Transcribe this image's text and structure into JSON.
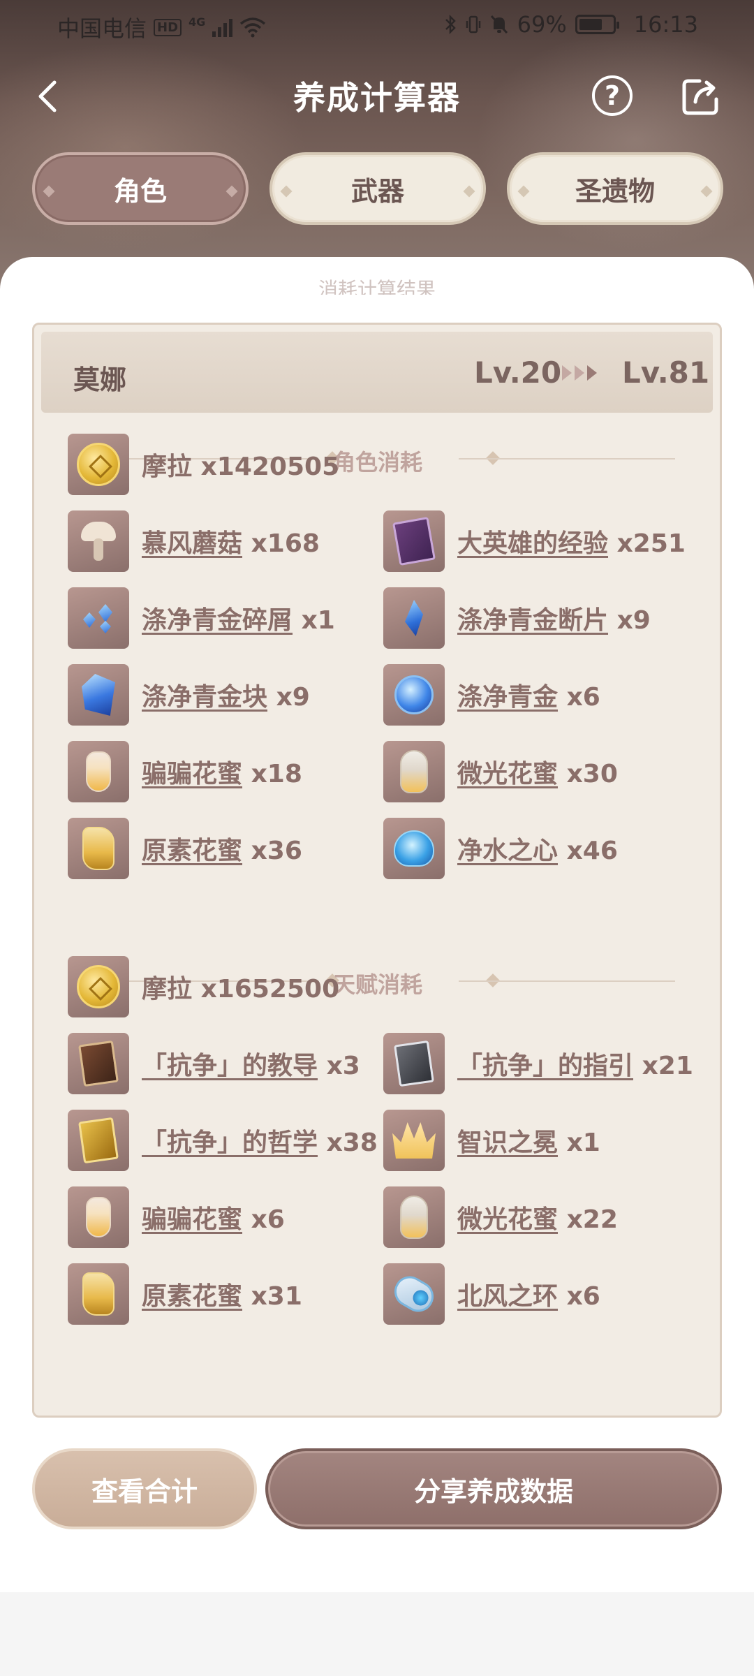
{
  "status_bar": {
    "carrier": "中国电信",
    "network_badge": "HD",
    "network_type": "4G",
    "battery_percent": "69%",
    "battery_level": 0.69,
    "time": "16:13"
  },
  "header": {
    "title": "养成计算器",
    "help_symbol": "?",
    "icons": {
      "back": "chevron-left-icon",
      "help": "question-circle-icon",
      "share": "share-icon"
    }
  },
  "tabs": [
    {
      "label": "角色",
      "active": true
    },
    {
      "label": "武器",
      "active": false
    },
    {
      "label": "圣遗物",
      "active": false
    }
  ],
  "sheet": {
    "subtitle": "消耗计算结果"
  },
  "character": {
    "name": "莫娜",
    "level_from": "Lv.20",
    "level_to": "Lv.81"
  },
  "sections": [
    {
      "title": "角色消耗",
      "items": [
        {
          "name": "摩拉",
          "qty": "x1420505",
          "icon": "mora-coin-icon",
          "link": false
        },
        {
          "name": "慕风蘑菇",
          "qty": "x168",
          "icon": "mushroom-icon",
          "link": true
        },
        {
          "name": "大英雄的经验",
          "qty": "x251",
          "icon": "exp-book-icon",
          "link": true
        },
        {
          "name": "涤净青金碎屑",
          "qty": "x1",
          "icon": "lapis-sliver-icon",
          "link": true
        },
        {
          "name": "涤净青金断片",
          "qty": "x9",
          "icon": "lapis-fragment-icon",
          "link": true
        },
        {
          "name": "涤净青金块",
          "qty": "x9",
          "icon": "lapis-chunk-icon",
          "link": true
        },
        {
          "name": "涤净青金",
          "qty": "x6",
          "icon": "lapis-gemstone-icon",
          "link": true
        },
        {
          "name": "骗骗花蜜",
          "qty": "x18",
          "icon": "whopperflower-nectar-icon",
          "link": true
        },
        {
          "name": "微光花蜜",
          "qty": "x30",
          "icon": "shimmering-nectar-icon",
          "link": true
        },
        {
          "name": "原素花蜜",
          "qty": "x36",
          "icon": "energy-nectar-icon",
          "link": true
        },
        {
          "name": "净水之心",
          "qty": "x46",
          "icon": "cleansing-heart-icon",
          "link": true
        }
      ]
    },
    {
      "title": "天赋消耗",
      "items": [
        {
          "name": "摩拉",
          "qty": "x1652500",
          "icon": "mora-coin-icon",
          "link": false
        },
        {
          "name": "「抗争」的教导",
          "qty": "x3",
          "icon": "teachings-book-icon",
          "link": true
        },
        {
          "name": "「抗争」的指引",
          "qty": "x21",
          "icon": "guide-book-icon",
          "link": true
        },
        {
          "name": "「抗争」的哲学",
          "qty": "x38",
          "icon": "philosophies-book-icon",
          "link": true
        },
        {
          "name": "智识之冕",
          "qty": "x1",
          "icon": "crown-icon",
          "link": true
        },
        {
          "name": "骗骗花蜜",
          "qty": "x6",
          "icon": "whopperflower-nectar-icon",
          "link": true
        },
        {
          "name": "微光花蜜",
          "qty": "x22",
          "icon": "shimmering-nectar-icon",
          "link": true
        },
        {
          "name": "原素花蜜",
          "qty": "x31",
          "icon": "energy-nectar-icon",
          "link": true
        },
        {
          "name": "北风之环",
          "qty": "x6",
          "icon": "boreal-ring-icon",
          "link": true
        }
      ]
    }
  ],
  "actions": {
    "view_total": "查看合计",
    "share_data": "分享养成数据"
  }
}
